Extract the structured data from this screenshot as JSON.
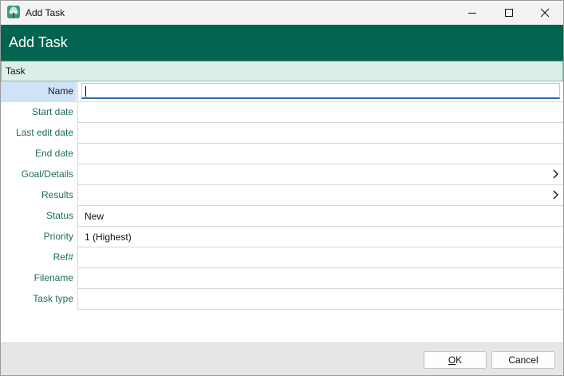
{
  "window": {
    "title": "Add Task"
  },
  "header": {
    "title": "Add Task"
  },
  "section": {
    "label": "Task"
  },
  "fields": [
    {
      "id": "name",
      "label": "Name",
      "value": "",
      "active": true
    },
    {
      "id": "start-date",
      "label": "Start date",
      "value": ""
    },
    {
      "id": "last-edit-date",
      "label": "Last edit date",
      "value": ""
    },
    {
      "id": "end-date",
      "label": "End date",
      "value": ""
    },
    {
      "id": "goal-details",
      "label": "Goal/Details",
      "value": "",
      "expandable": true
    },
    {
      "id": "results",
      "label": "Results",
      "value": "",
      "expandable": true
    },
    {
      "id": "status",
      "label": "Status",
      "value": "New"
    },
    {
      "id": "priority",
      "label": "Priority",
      "value": "1 (Highest)"
    },
    {
      "id": "ref",
      "label": "Ref#",
      "value": ""
    },
    {
      "id": "filename",
      "label": "Filename",
      "value": ""
    },
    {
      "id": "task-type",
      "label": "Task type",
      "value": ""
    }
  ],
  "buttons": {
    "ok_mnemonic": "O",
    "ok_rest": "K",
    "cancel": "Cancel"
  },
  "colors": {
    "header": "#006450",
    "label": "#1e6f5a",
    "section_bg": "#dcefe9",
    "active_label_bg": "#cfe2f7"
  },
  "icons": {
    "app": "tree-icon",
    "chevron": "chevron-right-icon"
  }
}
